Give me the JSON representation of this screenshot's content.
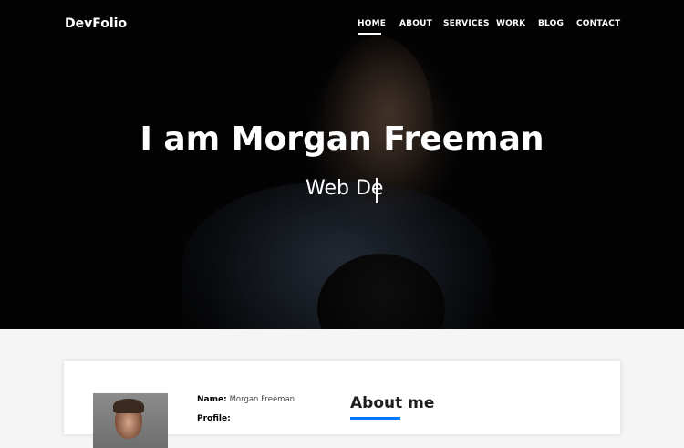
{
  "brand": "DevFolio",
  "nav": {
    "items": [
      "HOME",
      "ABOUT",
      "SERVICES",
      "WORK",
      "BLOG",
      "CONTACT"
    ],
    "active": "HOME"
  },
  "hero": {
    "title": "I am Morgan Freeman",
    "typed_text": "Web De"
  },
  "about": {
    "name_label": "Name:",
    "name_value": "Morgan Freeman",
    "profile_label": "Profile:",
    "heading": "About me",
    "accent_color": "#0078ff"
  }
}
